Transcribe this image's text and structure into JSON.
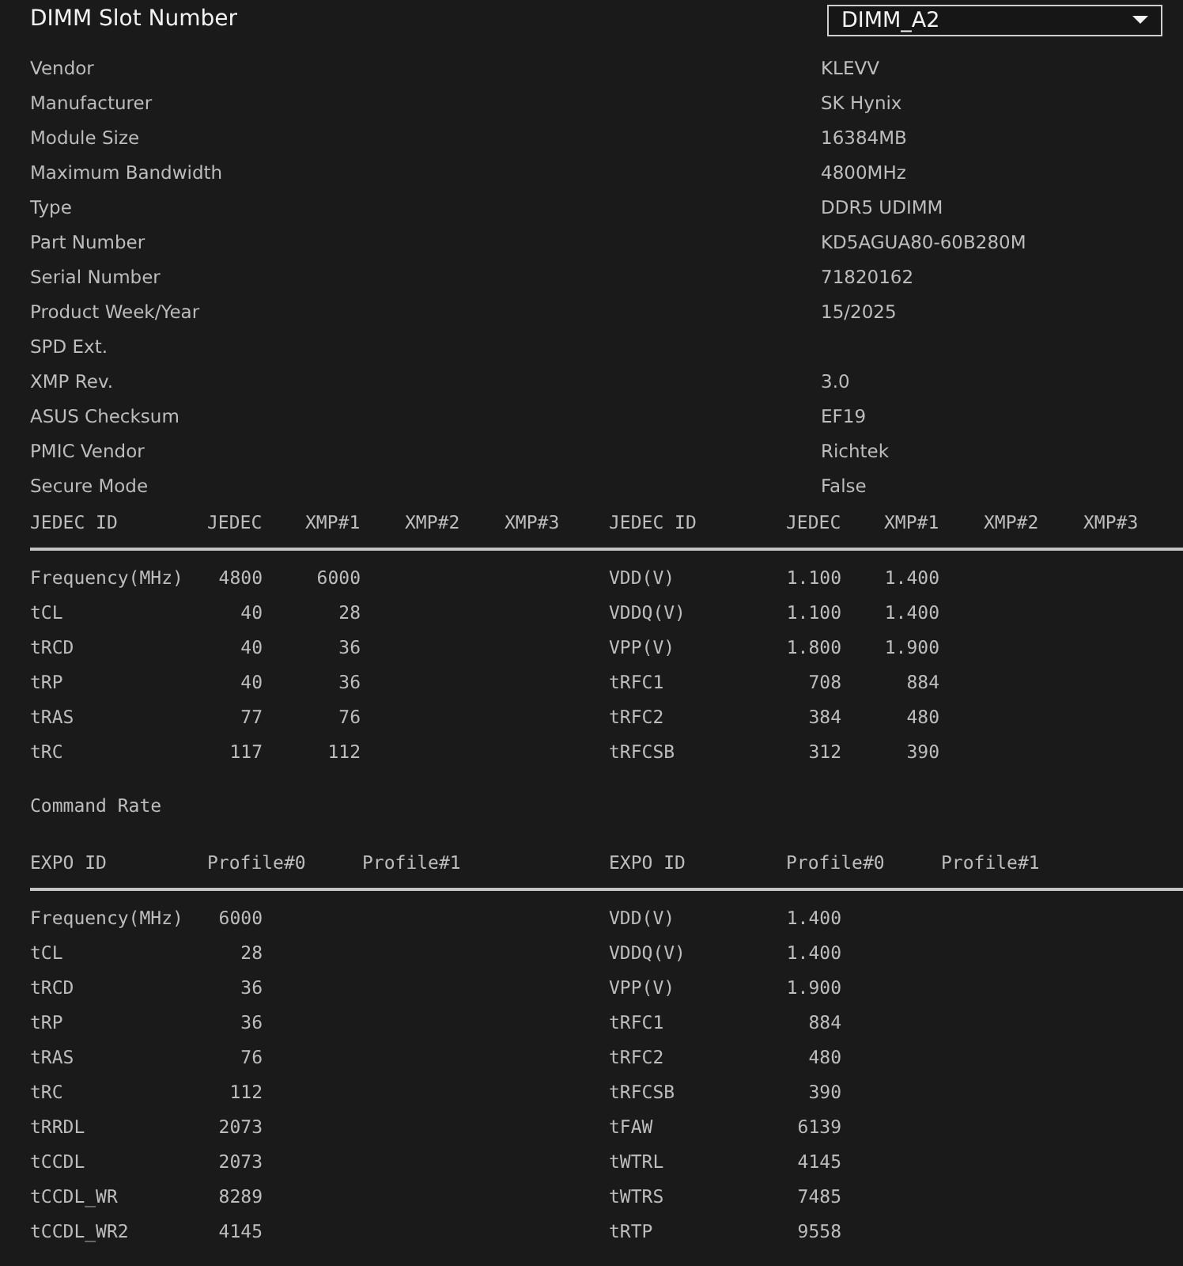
{
  "slot": {
    "label": "DIMM Slot Number",
    "value": "DIMM_A2"
  },
  "info": [
    {
      "label": "Vendor",
      "value": "KLEVV"
    },
    {
      "label": "Manufacturer",
      "value": "SK Hynix"
    },
    {
      "label": "Module Size",
      "value": "16384MB"
    },
    {
      "label": "Maximum Bandwidth",
      "value": "4800MHz"
    },
    {
      "label": "Type",
      "value": "DDR5 UDIMM"
    },
    {
      "label": "Part Number",
      "value": "KD5AGUA80-60B280M"
    },
    {
      "label": "Serial Number",
      "value": "71820162"
    },
    {
      "label": "Product Week/Year",
      "value": "15/2025"
    },
    {
      "label": "SPD Ext."
    },
    {
      "label": "XMP Rev.",
      "value": "3.0"
    },
    {
      "label": "ASUS Checksum",
      "value": "EF19"
    },
    {
      "label": "PMIC Vendor",
      "value": "Richtek"
    },
    {
      "label": "Secure Mode",
      "value": "False"
    }
  ],
  "sections": [
    {
      "kind": "jedec",
      "tables": [
        {
          "columns": [
            "JEDEC ID",
            "JEDEC",
            "XMP#1",
            "XMP#2",
            "XMP#3"
          ],
          "rows": [
            [
              "Frequency(MHz)",
              "4800",
              "6000"
            ],
            [
              "tCL",
              "40",
              "28"
            ],
            [
              "tRCD",
              "40",
              "36"
            ],
            [
              "tRP",
              "40",
              "36"
            ],
            [
              "tRAS",
              "77",
              "76"
            ],
            [
              "tRC",
              "117",
              "112"
            ]
          ]
        },
        {
          "columns": [
            "JEDEC ID",
            "JEDEC",
            "XMP#1",
            "XMP#2",
            "XMP#3"
          ],
          "rows": [
            [
              "VDD(V)",
              "1.100",
              "1.400"
            ],
            [
              "VDDQ(V)",
              "1.100",
              "1.400"
            ],
            [
              "VPP(V)",
              "1.800",
              "1.900"
            ],
            [
              "tRFC1",
              "708",
              "884"
            ],
            [
              "tRFC2",
              "384",
              "480"
            ],
            [
              "tRFCSB",
              "312",
              "390"
            ]
          ]
        }
      ],
      "footer": "Command Rate"
    },
    {
      "kind": "expo",
      "tables": [
        {
          "columns": [
            "EXPO ID",
            "Profile#0",
            "Profile#1"
          ],
          "rows": [
            [
              "Frequency(MHz)",
              "6000"
            ],
            [
              "tCL",
              "28"
            ],
            [
              "tRCD",
              "36"
            ],
            [
              "tRP",
              "36"
            ],
            [
              "tRAS",
              "76"
            ],
            [
              "tRC",
              "112"
            ],
            [
              "tRRDL",
              "2073"
            ],
            [
              "tCCDL",
              "2073"
            ],
            [
              "tCCDL_WR",
              "8289"
            ],
            [
              "tCCDL_WR2",
              "4145"
            ]
          ]
        },
        {
          "columns": [
            "EXPO ID",
            "Profile#0",
            "Profile#1"
          ],
          "rows": [
            [
              "VDD(V)",
              "1.400"
            ],
            [
              "VDDQ(V)",
              "1.400"
            ],
            [
              "VPP(V)",
              "1.900"
            ],
            [
              "tRFC1",
              "884"
            ],
            [
              "tRFC2",
              "480"
            ],
            [
              "tRFCSB",
              "390"
            ],
            [
              "tFAW",
              "6139"
            ],
            [
              "tWTRL",
              "4145"
            ],
            [
              "tWTRS",
              "7485"
            ],
            [
              "tRTP",
              "9558"
            ]
          ]
        }
      ]
    }
  ]
}
